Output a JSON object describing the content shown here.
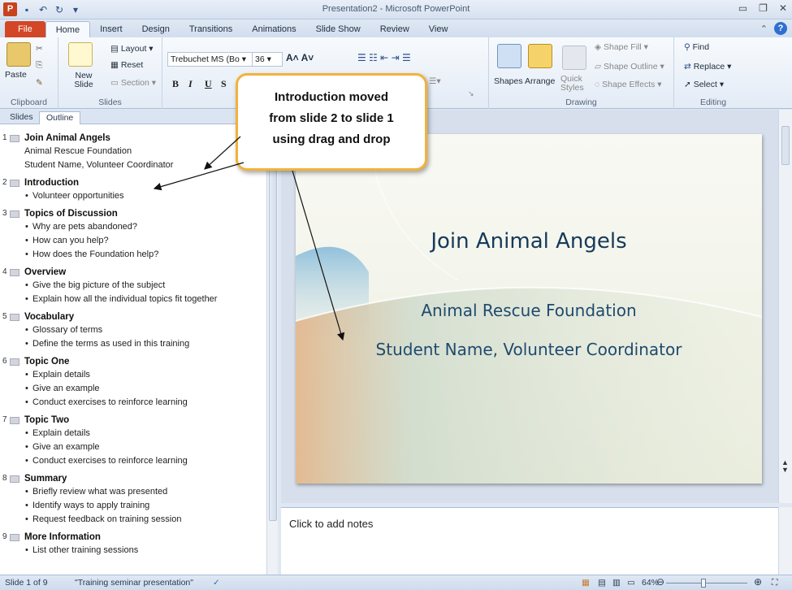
{
  "window": {
    "title": "Presentation2 - Microsoft PowerPoint",
    "app_logo": "P",
    "qat": [
      "save-icon",
      "undo-icon",
      "redo-icon",
      "customize-icon"
    ],
    "controls": [
      "minimize",
      "restore",
      "close"
    ]
  },
  "tabs": [
    "File",
    "Home",
    "Insert",
    "Design",
    "Transitions",
    "Animations",
    "Slide Show",
    "Review",
    "View"
  ],
  "ribbon": {
    "clipboard": {
      "paste": "Paste",
      "label": "Clipboard"
    },
    "slides": {
      "new_slide": "New Slide",
      "layout": "Layout",
      "reset": "Reset",
      "section": "Section",
      "label": "Slides"
    },
    "font": {
      "name": "Trebuchet MS (Bo",
      "size": "36",
      "bold": "B",
      "italic": "I",
      "underline": "U",
      "strike": "S"
    },
    "drawing": {
      "shapes": "Shapes",
      "arrange": "Arrange",
      "quick_styles": "Quick Styles",
      "shape_fill": "Shape Fill",
      "shape_outline": "Shape Outline",
      "shape_effects": "Shape Effects",
      "label": "Drawing"
    },
    "editing": {
      "find": "Find",
      "replace": "Replace",
      "select": "Select",
      "label": "Editing"
    }
  },
  "left_pane": {
    "tabs": [
      "Slides",
      "Outline"
    ],
    "active": "Outline"
  },
  "outline": [
    {
      "num": "1",
      "title": "Join Animal Angels",
      "lines": [
        "Animal Rescue Foundation",
        "Student Name, Volunteer Coordinator"
      ],
      "bullets": []
    },
    {
      "num": "2",
      "title": "Introduction",
      "lines": [],
      "bullets": [
        "Volunteer opportunities"
      ]
    },
    {
      "num": "3",
      "title": "Topics of Discussion",
      "lines": [],
      "bullets": [
        "Why are pets abandoned?",
        "How can you help?",
        "How does the Foundation help?"
      ]
    },
    {
      "num": "4",
      "title": "Overview",
      "lines": [],
      "bullets": [
        "Give the big picture of the subject",
        "Explain how all the individual topics fit together"
      ]
    },
    {
      "num": "5",
      "title": "Vocabulary",
      "lines": [],
      "bullets": [
        "Glossary of terms",
        "Define the terms as used in this training"
      ]
    },
    {
      "num": "6",
      "title": "Topic One",
      "lines": [],
      "bullets": [
        "Explain details",
        "Give an example",
        "Conduct exercises to reinforce learning"
      ]
    },
    {
      "num": "7",
      "title": "Topic Two",
      "lines": [],
      "bullets": [
        "Explain details",
        "Give an example",
        "Conduct exercises to reinforce learning"
      ]
    },
    {
      "num": "8",
      "title": "Summary",
      "lines": [],
      "bullets": [
        "Briefly review what was presented",
        "Identify ways to apply training",
        "Request feedback on training session"
      ]
    },
    {
      "num": "9",
      "title": "More Information",
      "lines": [],
      "bullets": [
        "List other training sessions"
      ]
    }
  ],
  "slide": {
    "title": "Join Animal Angels",
    "subtitle1": "Animal Rescue Foundation",
    "subtitle2": "Student Name, Volunteer Coordinator"
  },
  "notes": {
    "placeholder": "Click to add notes"
  },
  "callout": {
    "line1": "Introduction moved",
    "line2": "from slide 2 to slide 1",
    "line3": "using drag and drop"
  },
  "status": {
    "slide_info": "Slide 1 of 9",
    "theme": "\"Training seminar presentation\"",
    "zoom": "64%",
    "zoom_fraction": 0.64
  },
  "colors": {
    "file_tab": "#d24726",
    "callout_border": "#f2b23a",
    "slide_title": "#163a5a"
  }
}
